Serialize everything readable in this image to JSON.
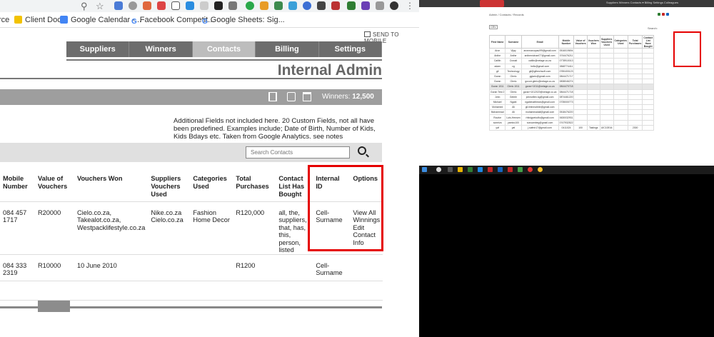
{
  "browser": {
    "bookmarks": [
      {
        "label": "rce",
        "icon": "none"
      },
      {
        "label": "Client Docs",
        "icon": "folder-icon"
      },
      {
        "label": "Google Calendar -...",
        "icon": "calendar-icon"
      },
      {
        "label": "Facebook Competit...",
        "icon": "google-g-icon"
      },
      {
        "label": "Google Sheets: Sig...",
        "icon": "google-g-icon"
      }
    ],
    "send_to_mobile": "SEND TO MOBILE"
  },
  "nav": {
    "items": [
      "Suppliers",
      "Winners",
      "Contacts",
      "Billing",
      "Settings"
    ],
    "active": "Contacts"
  },
  "page_title": "Internal Admin",
  "winners_label": "Winners:",
  "winners_count": "12,500",
  "note": "Additional Fields not included here. 20 Custom Fields, not all have been predefined. Examples include; Date of Birth, Number of Kids, Kids Bdays etc. Taken from Google Analytics. see notes",
  "search": {
    "placeholder": "Search Contacts"
  },
  "table": {
    "headers": [
      "Mobile Number",
      "Value of Vouchers",
      "Vouchers Won",
      "Suppliers Vouchers Used",
      "Categories Used",
      "Total Purchases",
      "Contact List Has Bought",
      "Internal ID",
      "Options"
    ],
    "rows": [
      {
        "mobile": "084 457 1717",
        "value": "R20000",
        "won": "Cielo.co.za, Takealot.co.za, Westpacklifestyle.co.za",
        "suppliers": "Nike.co.za Cielo.co.za",
        "categories": "Fashion Home Decor",
        "total": "R120,000",
        "bought": "all, the, suppliers, that, has, this, person, listed",
        "internal_id": "Cell-Surname",
        "options": [
          "View All Winnings",
          "Edit Contact Info"
        ]
      },
      {
        "mobile": "084 333 2319",
        "value": "R10000",
        "won": "10 June 2010",
        "suppliers": "",
        "categories": "",
        "total": "R1200",
        "bought": "",
        "internal_id": "Cell-Surname",
        "options": []
      }
    ]
  },
  "mini": {
    "nav": "Suppliers  Winners  Contacts ▾  Billing  Settings  Colleagues",
    "breadcrumb": "Admin / Contacts / Records",
    "csv": "CSV",
    "search_label": "Search:",
    "headers": [
      "First Name",
      "Surname",
      "Email",
      "Mobile Number",
      "Value of Vouchers",
      "Vouchers Won",
      "Suppliers Vouchers Used",
      "Categories Used",
      "Total Purchases",
      "Contact List Have Bought"
    ],
    "rows": [
      [
        "Aron",
        "Vijay",
        "aronmarcopaul99@gmail.com",
        "0516019694"
      ],
      [
        "Anthe",
        "Anthe",
        "anthemichael77@gmail.com",
        "0744476211"
      ],
      [
        "Caitlin",
        "Crossit",
        "caitlin@netage.co.za",
        "0778910013"
      ],
      [
        "adam",
        "cg",
        "hello@gmail.com",
        "0848774411"
      ],
      [
        "gil",
        "Technology",
        "gil@gilhechsoft.com",
        "0780400123"
      ],
      [
        "Goran",
        "Gleric",
        "gglaric@gmail.com",
        "0844471717"
      ],
      [
        "Goran",
        "Gleric",
        "gocorr.gleric@netage.co.za",
        "0838046274"
      ],
      [
        "Goran 1011",
        "Gleric 1011",
        "goran+1011@netage.co.za",
        "0844470718"
      ],
      [
        "Goran Test 2",
        "Gleric",
        "goran+1012020@netage.co.za",
        "0844471718"
      ],
      [
        "John",
        "Gebrle",
        "johnsellen.kg@gmail.com",
        "0874461220"
      ],
      [
        "Michael",
        "Ngabi",
        "ngabimatthews@gmail.com",
        "0735000773"
      ],
      [
        "Mohamed",
        "Ali",
        "gil.timhmobble@gmail.com",
        ""
      ],
      [
        "Muhammad",
        "Ali",
        "muhammadali@gmail.com",
        "0518476220"
      ],
      [
        "Rourke",
        "Luts-Hensen",
        "rhitstypetodfo@gmail.com",
        "0630032931"
      ],
      [
        "soneiva",
        "yambo100",
        "soncambeg@gmail.com",
        "0747932522"
      ],
      [
        "yaf",
        "yaf",
        "j.safmir17@gmail.com",
        "0411024",
        "100",
        "Tastings",
        "UIC10E44",
        "",
        "2300",
        ""
      ]
    ],
    "highlight_row": 7
  },
  "colors": {
    "nav_bg": "#6d6d6d",
    "nav_active": "#bdbdbd",
    "red_highlight": "#e50000"
  }
}
